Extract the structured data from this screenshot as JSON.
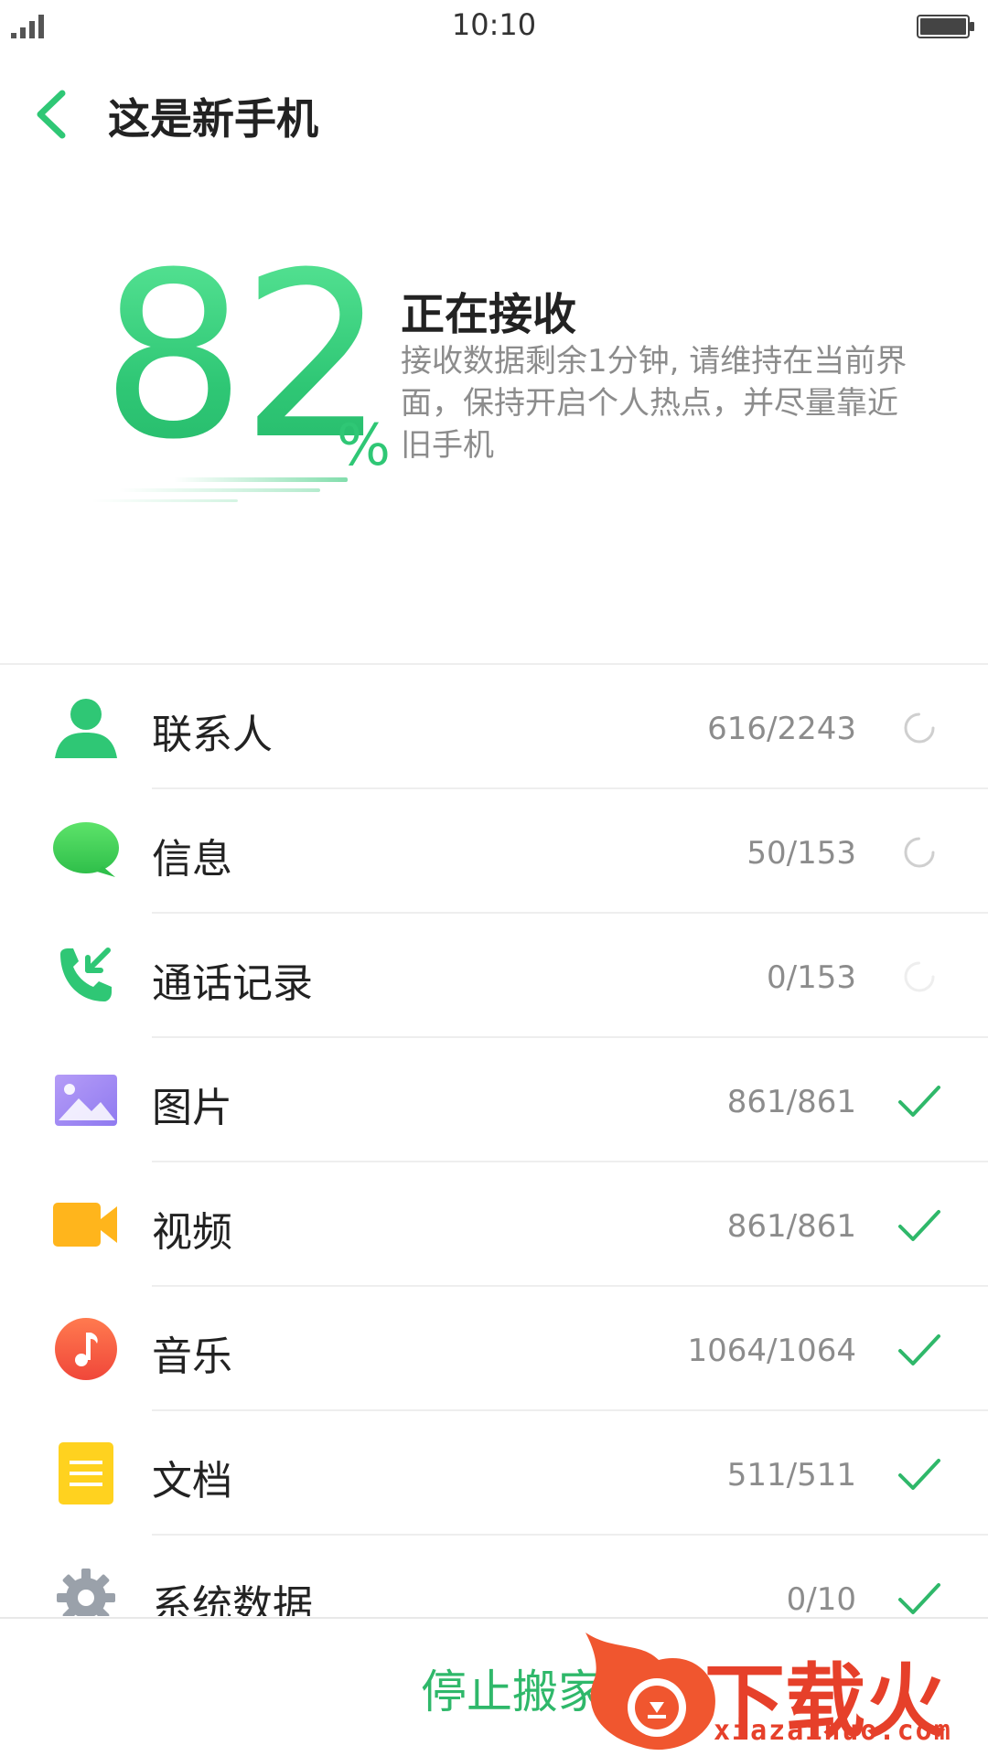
{
  "status_bar": {
    "time": "10:10",
    "signal_icon": "signal-icon",
    "battery_icon": "battery-icon"
  },
  "header": {
    "back_icon": "chevron-left-icon",
    "title": "这是新手机"
  },
  "progress": {
    "value": "82",
    "unit": "%",
    "percent": 82,
    "status": "正在接收",
    "description": "接收数据剩余1分钟, 请维持在当前界面，保持开启个人热点，并尽量靠近旧手机"
  },
  "colors": {
    "accent_green": "#2fc775",
    "text_primary": "#222222",
    "text_secondary": "#8c8c8c"
  },
  "categories": [
    {
      "label": "联系人",
      "count": "616/2243",
      "state": "loading",
      "icon": "contact-icon"
    },
    {
      "label": "信息",
      "count": "50/153",
      "state": "loading",
      "icon": "message-icon"
    },
    {
      "label": "通话记录",
      "count": "0/153",
      "state": "waiting",
      "icon": "call-log-icon"
    },
    {
      "label": "图片",
      "count": "861/861",
      "state": "done",
      "icon": "image-icon"
    },
    {
      "label": "视频",
      "count": "861/861",
      "state": "done",
      "icon": "video-icon"
    },
    {
      "label": "音乐",
      "count": "1064/1064",
      "state": "done",
      "icon": "music-icon"
    },
    {
      "label": "文档",
      "count": "511/511",
      "state": "done",
      "icon": "document-icon"
    },
    {
      "label": "系统数据",
      "count": "0/10",
      "state": "done",
      "icon": "settings-gear-icon"
    }
  ],
  "footer": {
    "stop_label": "停止搬家"
  },
  "watermark": {
    "logo": "下载火",
    "url": "xiazaihuo.com"
  }
}
